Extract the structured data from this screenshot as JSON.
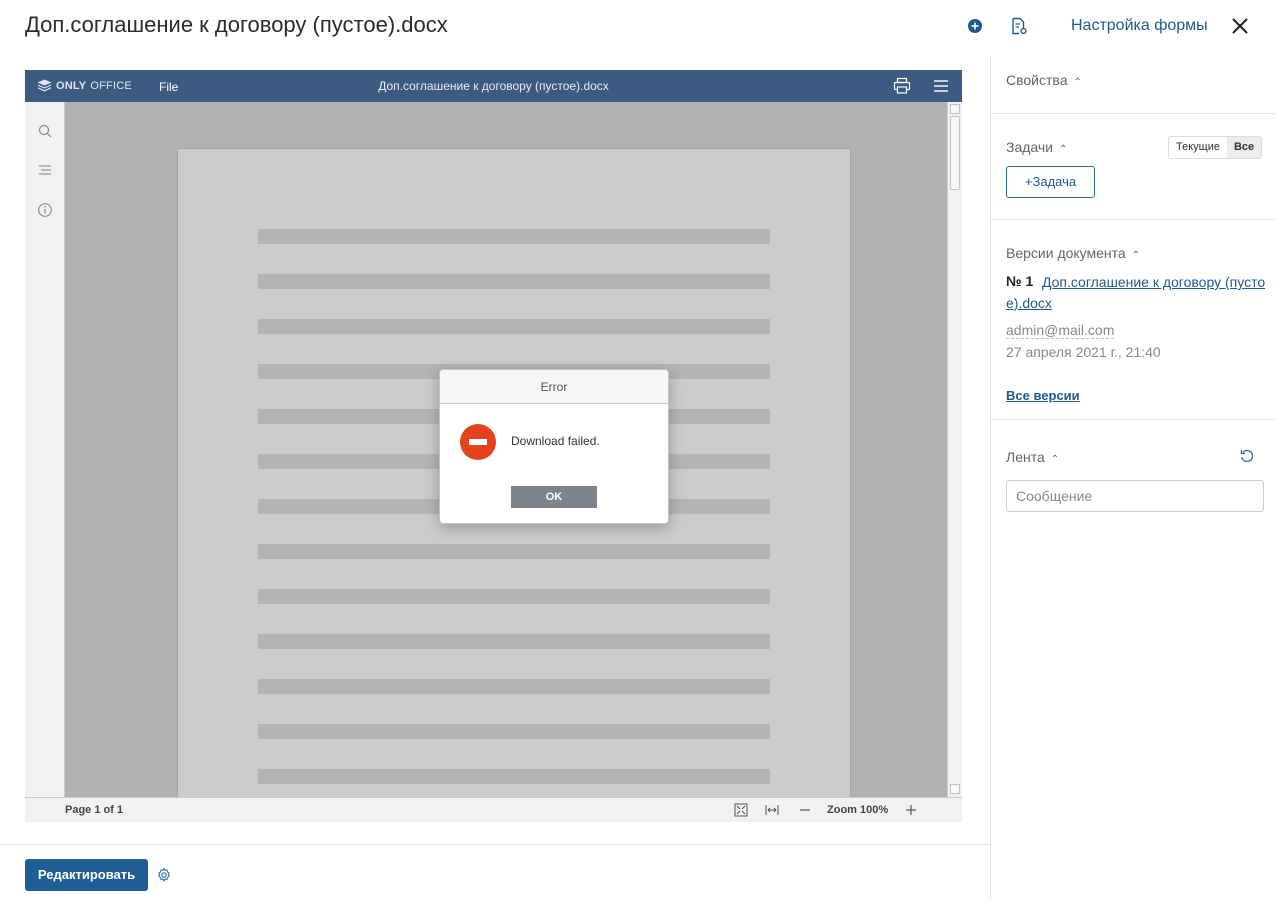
{
  "header": {
    "title": "Доп.соглашение к договору (пустое).docx",
    "form_settings_label": "Настройка формы",
    "icons": [
      "plus-circle-icon",
      "document-settings-icon",
      "close-icon"
    ]
  },
  "viewer": {
    "logo_bold": "ONLY",
    "logo_regular": "OFFICE",
    "file_menu": "File",
    "doc_title": "Доп.соглашение к договору (пустое).docx",
    "status": {
      "page_info": "Page 1 of 1",
      "zoom_label": "Zoom 100%"
    }
  },
  "dialog": {
    "title": "Error",
    "message": "Download failed.",
    "ok_label": "OK"
  },
  "footer": {
    "edit_label": "Редактировать"
  },
  "sidebar": {
    "properties_title": "Свойства",
    "tasks_title": "Задачи",
    "tasks_filter": {
      "current": "Текущие",
      "all": "Все",
      "selected": "all"
    },
    "add_task_label": "+Задача",
    "versions_title": "Версии документа",
    "version": {
      "number": "№ 1",
      "file_name": "Доп.соглашение к договору (пустое).docx",
      "author": "admin@mail.com",
      "date": "27 апреля 2021 г., 21:40"
    },
    "all_versions_label": "Все версии",
    "feed_title": "Лента",
    "message_placeholder": "Сообщение"
  },
  "colors": {
    "accent": "#1e5b8c",
    "editor_bar": "#3d5a80",
    "error_icon": "#e5431e"
  }
}
